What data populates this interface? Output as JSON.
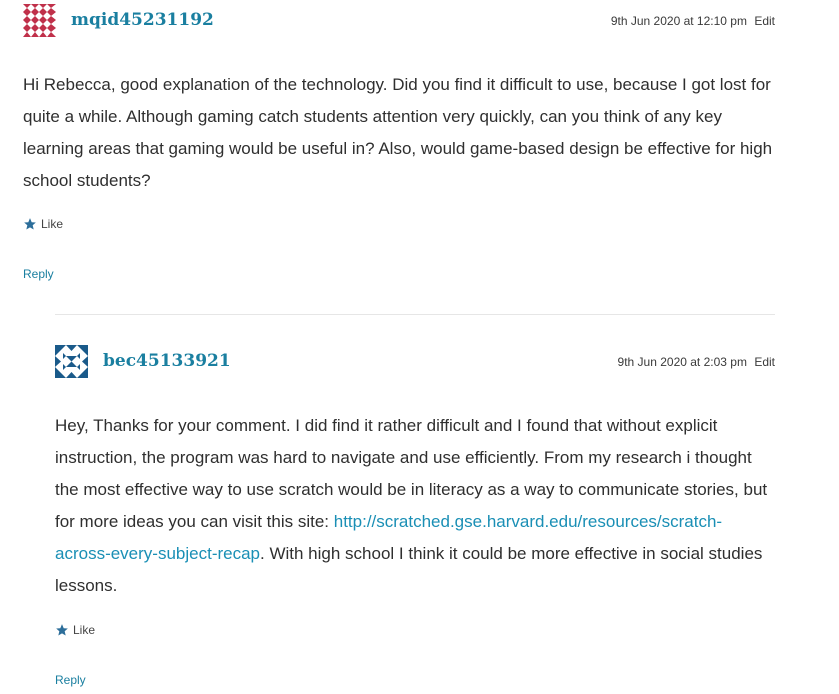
{
  "comments": [
    {
      "author": "mqid45231192",
      "timestamp": "9th Jun 2020 at 12:10 pm",
      "edit_label": "Edit",
      "body": "Hi Rebecca, good explanation of the technology. Did you find it difficult to use, because I got lost for quite a while. Although gaming catch students attention very quickly, can you think of any key learning areas that gaming would be useful in? Also, would game-based design be effective for high school students?",
      "like_label": "Like",
      "reply_label": "Reply",
      "avatar_color": "#c0304a"
    },
    {
      "author": "bec45133921",
      "timestamp": "9th Jun 2020 at 2:03 pm",
      "edit_label": "Edit",
      "body_before": "Hey, Thanks for your comment. I did find it rather difficult and I found that without explicit instruction, the program was hard to navigate and use efficiently. From my research i thought the most effective way to use scratch would be in literacy as a way to communicate stories, but for more ideas you can visit this site: ",
      "link_text": "http://scratched.gse.harvard.edu/resources/scratch-across-every-subject-recap",
      "body_after": ". With high school I think it could be more effective in social studies lessons.",
      "like_label": "Like",
      "reply_label": "Reply",
      "avatar_color": "#1a5a8a"
    }
  ],
  "colors": {
    "link": "#1a8fb5",
    "author": "#1a7fa0",
    "text": "#2f2f2f"
  }
}
